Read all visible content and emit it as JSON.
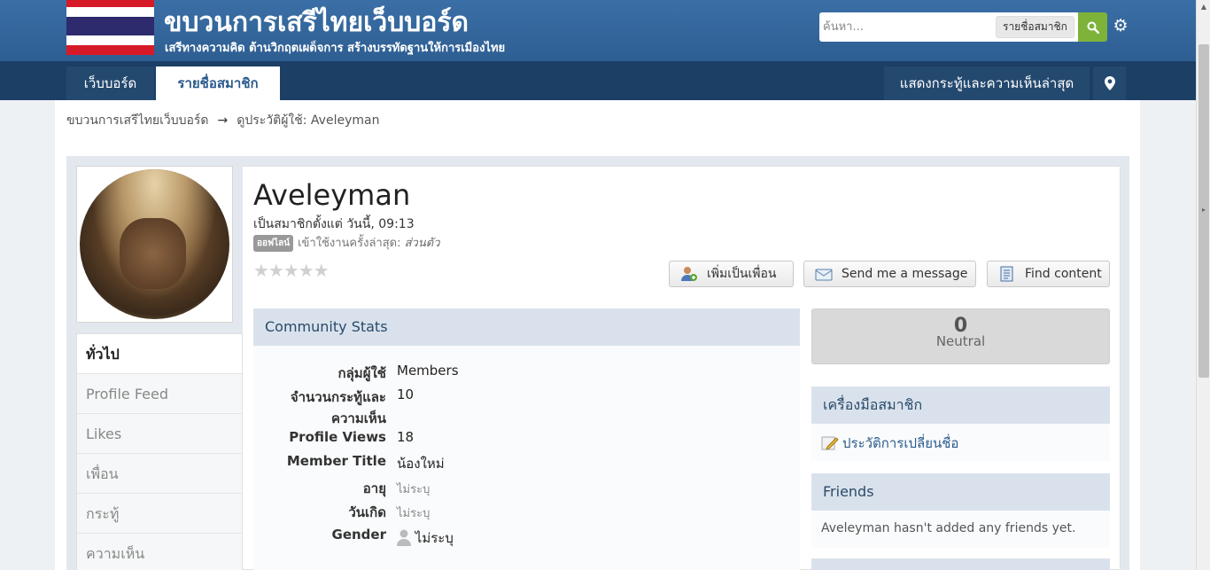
{
  "header": {
    "site_title": "ขบวนการเสรีไทยเว็บบอร์ด",
    "tagline": "เสรีทางความคิด ต้านวิกฤตเผด็จการ สร้างบรรทัดฐานให้การเมืองไทย",
    "search_placeholder": "ค้นหา...",
    "search_scope": "รายชื่อสมาชิก"
  },
  "nav": {
    "tabs": [
      {
        "label": "เว็บบอร์ด"
      },
      {
        "label": "รายชื่อสมาชิก"
      }
    ],
    "right_link": "แสดงกระทู้และความเห็นล่าสุด"
  },
  "breadcrumb": {
    "home": "ขบวนการเสรีไทยเว็บบอร์ด",
    "arrow": "→",
    "current": "ดูประวัติผู้ใช้: Aveleyman"
  },
  "sidebar": {
    "items": [
      {
        "label": "ทั่วไป"
      },
      {
        "label": "Profile Feed"
      },
      {
        "label": "Likes"
      },
      {
        "label": "เพื่อน"
      },
      {
        "label": "กระทู้"
      },
      {
        "label": "ความเห็น"
      }
    ]
  },
  "profile": {
    "username": "Aveleyman",
    "member_since": "เป็นสมาชิกตั้งแต่ วันนี้, 09:13",
    "status_badge": "ออฟไลน์",
    "last_active_label": "เข้าใช้งานครั้งล่าสุด:",
    "last_active_value": "ส่วนตัว",
    "rating_stars": "★★★★★",
    "buttons": {
      "add_friend": "เพิ่มเป็นเพื่อน",
      "send_message": "Send me a message",
      "find_content": "Find content"
    }
  },
  "stats": {
    "title": "Community Stats",
    "rows": [
      {
        "label": "กลุ่มผู้ใช้",
        "value": "Members"
      },
      {
        "label": "จำนวนกระทู้และ",
        "label2": "ความเห็น",
        "value": "10"
      },
      {
        "label": "Profile Views",
        "value": "18"
      },
      {
        "label": "Member Title",
        "value": "น้องใหม่"
      },
      {
        "label": "อายุ",
        "value": "ไม่ระบุ"
      },
      {
        "label": "วันเกิด",
        "value": "ไม่ระบุ"
      },
      {
        "label": "Gender",
        "value": "ไม่ระบุ"
      }
    ]
  },
  "reputation": {
    "value": "0",
    "label": "Neutral"
  },
  "member_tools": {
    "title": "เครื่องมือสมาชิก",
    "link": "ประวัติการเปลี่ยนชื่อ"
  },
  "friends": {
    "title": "Friends",
    "empty_text": "Aveleyman hasn't added any friends yet."
  },
  "colors": {
    "header_blue": "#2e5e92",
    "nav_dark": "#1c3f66",
    "search_green": "#7eb33a",
    "panel_head": "#d9e2ec"
  }
}
